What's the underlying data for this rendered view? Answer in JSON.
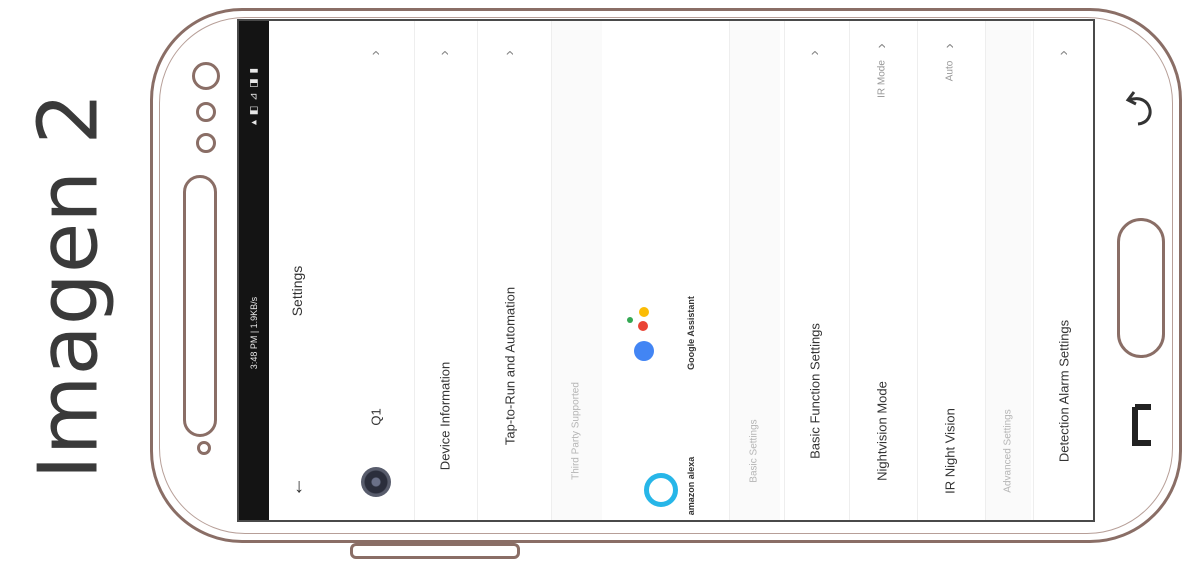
{
  "caption": "Imagen 2",
  "status_bar": {
    "time": "3:48 PM | 1.9KB/s",
    "icons": "▴ ◧ ⊿ ◨ ▮"
  },
  "header": {
    "title": "Settings",
    "back_icon": "back-arrow-icon"
  },
  "device": {
    "name": "Q1"
  },
  "menu": {
    "device_information": "Device Information",
    "tap_to_run": "Tap-to-Run and Automation"
  },
  "third_party": {
    "section_label": "Third Party Supported",
    "amazon_alexa": "amazon alexa",
    "google_assistant": "Google Assistant"
  },
  "basic_settings": {
    "section_label": "Basic Settings",
    "basic_function": "Basic Function Settings",
    "nightvision_mode": "Nightvision Mode",
    "nightvision_value": "IR Mode",
    "ir_night_vision": "IR Night Vision",
    "ir_night_vision_value": "Auto"
  },
  "advanced_settings": {
    "section_label": "Advanced Settings",
    "detection_alarm": "Detection Alarm Settings"
  },
  "colors": {
    "frame": "#8a6e66",
    "status_bar": "#141414",
    "alexa": "#27b6e8",
    "google_blue": "#4285f4",
    "google_red": "#ea4335",
    "google_yellow": "#fbbc05",
    "google_green": "#34a853"
  }
}
